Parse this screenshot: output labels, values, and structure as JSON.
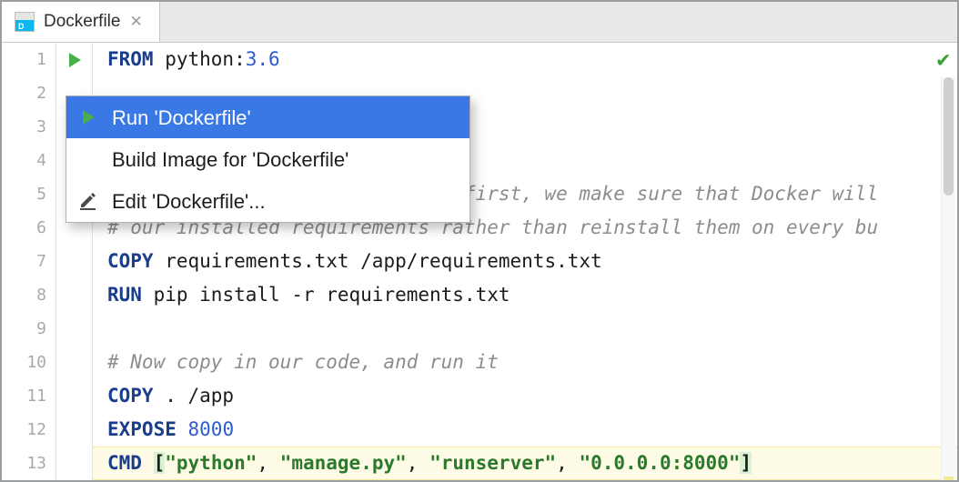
{
  "tab": {
    "title": "Dockerfile"
  },
  "gutter": {
    "lines": [
      "1",
      "2",
      "3",
      "4",
      "5",
      "6",
      "7",
      "8",
      "9",
      "10",
      "11",
      "12",
      "13"
    ]
  },
  "code": {
    "l1": {
      "from": "FROM",
      "rest": " python:",
      "ver": "3.6"
    },
    "l5": "# By copying over requirements first, we make sure that Docker will",
    "l6": "# our installed requirements rather than reinstall them on every bu",
    "l7": {
      "kw": "COPY",
      "rest": " requirements.txt /app/requirements.txt"
    },
    "l8": {
      "kw": "RUN",
      "rest": " pip install -r requirements.txt"
    },
    "l10": "# Now copy in our code, and run it",
    "l11": {
      "kw": "COPY",
      "rest": " . /app"
    },
    "l12": {
      "kw": "EXPOSE",
      "rest": " ",
      "ver": "8000"
    },
    "l13": {
      "kw": "CMD",
      "lbr": "[",
      "s1": "\"python\"",
      "c1": ", ",
      "s2": "\"manage.py\"",
      "c2": ", ",
      "s3": "\"runserver\"",
      "c3": ", ",
      "s4": "\"0.0.0.0:8000\"",
      "rbr": "]"
    }
  },
  "menu": {
    "items": [
      {
        "label": "Run 'Dockerfile'",
        "icon": "run"
      },
      {
        "label": "Build Image for 'Dockerfile'",
        "icon": ""
      },
      {
        "label": "Edit 'Dockerfile'...",
        "icon": "edit"
      }
    ],
    "selectedIndex": 0
  }
}
